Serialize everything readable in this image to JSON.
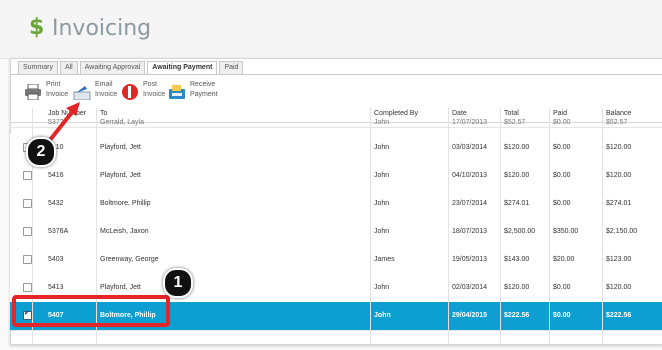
{
  "header": {
    "icon": "dollar-icon",
    "title": "Invoicing"
  },
  "tabs": [
    {
      "label": "Summary",
      "active": false
    },
    {
      "label": "All",
      "active": false
    },
    {
      "label": "Awaiting Approval",
      "active": false
    },
    {
      "label": "Awaiting Payment",
      "active": true
    },
    {
      "label": "Paid",
      "active": false
    }
  ],
  "toolbar": {
    "print_label": "Print\nInvoice",
    "email_label": "Email\nInvoice",
    "post_label": "Post\nInvoice",
    "receive_label": "Receive\nPayment"
  },
  "table": {
    "headers": [
      "Job Number",
      "To",
      "Completed By",
      "Date",
      "Total",
      "Paid",
      "Balance"
    ],
    "partial_row": {
      "job": "537?",
      "to": "Gerrald, Layla",
      "by": "John",
      "date": "17/07/2013",
      "total": "$52.57",
      "paid": "$0.00",
      "balance": "$52.57"
    },
    "rows": [
      {
        "job": "5410",
        "to": "Playford, Jett",
        "by": "John",
        "date": "03/03/2014",
        "total": "$120.00",
        "paid": "$0.00",
        "balance": "$120.00",
        "checked": false
      },
      {
        "job": "5416",
        "to": "Playford, Jett",
        "by": "John",
        "date": "04/10/2013",
        "total": "$120.00",
        "paid": "$0.00",
        "balance": "$120.00",
        "checked": false
      },
      {
        "job": "5432",
        "to": "Boltmore, Phillip",
        "by": "John",
        "date": "23/07/2014",
        "total": "$274.01",
        "paid": "$0.00",
        "balance": "$274.01",
        "checked": false
      },
      {
        "job": "5376A",
        "to": "McLeish, Jaxon",
        "by": "John",
        "date": "18/07/2013",
        "total": "$2,500.00",
        "paid": "$350.00",
        "balance": "$2,150.00",
        "checked": false
      },
      {
        "job": "5403",
        "to": "Greenway, George",
        "by": "James",
        "date": "19/05/2013",
        "total": "$143.00",
        "paid": "$20.00",
        "balance": "$123.00",
        "checked": false
      },
      {
        "job": "5413",
        "to": "Playford, Jett",
        "by": "John",
        "date": "02/03/2014",
        "total": "$120.00",
        "paid": "$0.00",
        "balance": "$120.00",
        "checked": false
      },
      {
        "job": "5407",
        "to": "Boltmore, Phillip",
        "by": "John",
        "date": "29/04/2015",
        "total": "$222.56",
        "paid": "$0.00",
        "balance": "$222.56",
        "checked": true
      }
    ]
  },
  "callouts": [
    {
      "number": "1"
    },
    {
      "number": "2"
    }
  ],
  "colors": {
    "selected_row": "#0e9fd2",
    "highlight": "#e52628",
    "dollar": "#6aa63b"
  }
}
